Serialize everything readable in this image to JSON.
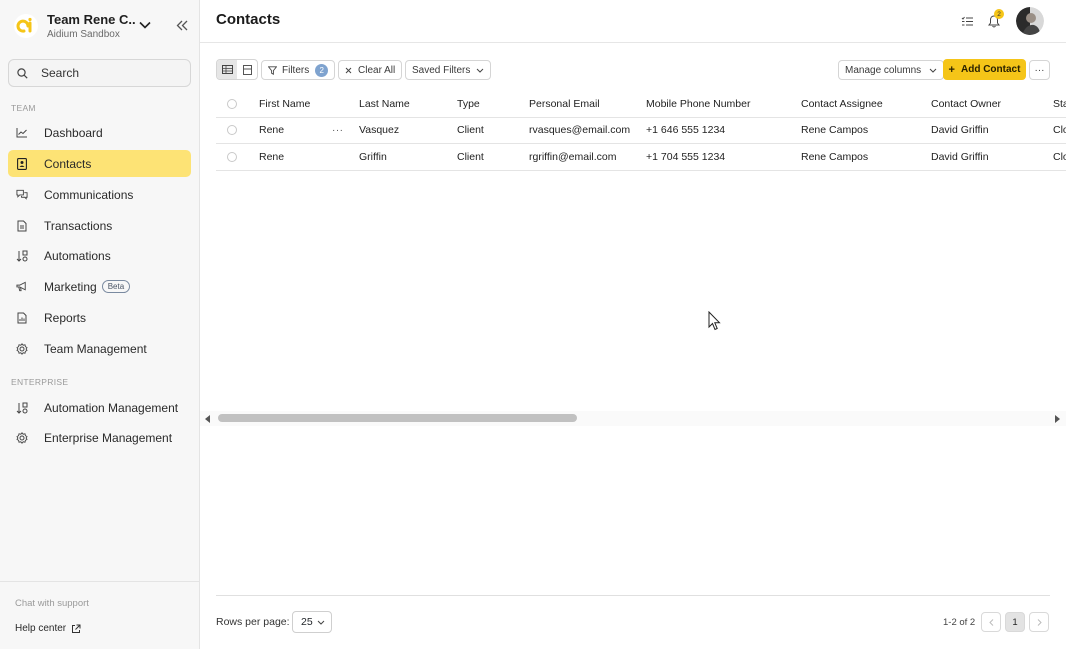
{
  "sidebar": {
    "team_name": "Team Rene C...",
    "team_sub": "Aidium Sandbox",
    "search_placeholder": "Search",
    "section_team": "TEAM",
    "section_enterprise": "ENTERPRISE",
    "items": [
      {
        "label": "Dashboard",
        "icon": "chart-line-icon"
      },
      {
        "label": "Contacts",
        "icon": "contact-book-icon",
        "active": true
      },
      {
        "label": "Communications",
        "icon": "chat-bubbles-icon"
      },
      {
        "label": "Transactions",
        "icon": "document-icon"
      },
      {
        "label": "Automations",
        "icon": "automation-icon"
      },
      {
        "label": "Marketing",
        "icon": "megaphone-icon",
        "badge": "Beta"
      },
      {
        "label": "Reports",
        "icon": "report-icon"
      },
      {
        "label": "Team Management",
        "icon": "gear-icon"
      }
    ],
    "enterprise_items": [
      {
        "label": "Automation Management",
        "icon": "automation-icon"
      },
      {
        "label": "Enterprise Management",
        "icon": "gear-icon"
      }
    ],
    "chat_support": "Chat with support",
    "help_center": "Help center"
  },
  "header": {
    "title": "Contacts",
    "notification_count": "2"
  },
  "toolbar": {
    "filters_label": "Filters",
    "filters_count": "2",
    "clear_all_label": "Clear All",
    "saved_filters_label": "Saved Filters",
    "manage_columns_label": "Manage columns",
    "add_contact_label": "Add Contact",
    "more_label": "···"
  },
  "table": {
    "columns": [
      "First Name",
      "Last Name",
      "Type",
      "Personal Email",
      "Mobile Phone Number",
      "Contact Assignee",
      "Contact Owner",
      "Sta"
    ],
    "rows": [
      [
        "Rene",
        "Vasquez",
        "Client",
        "rvasques@email.com",
        "+1 646 555 1234",
        "Rene Campos",
        "David Griffin",
        "Clo"
      ],
      [
        "Rene",
        "Griffin",
        "Client",
        "rgriffin@email.com",
        "+1 704 555 1234",
        "Rene Campos",
        "David Griffin",
        "Clo"
      ]
    ],
    "row_menu": "···"
  },
  "footer": {
    "rows_per_page_label": "Rows per page:",
    "rows_per_page_value": "25",
    "range_text": "1-2 of 2",
    "current_page": "1"
  },
  "colors": {
    "accent": "#f5c518",
    "active_nav": "#fde375",
    "badge_blue": "#7fa3cf"
  }
}
